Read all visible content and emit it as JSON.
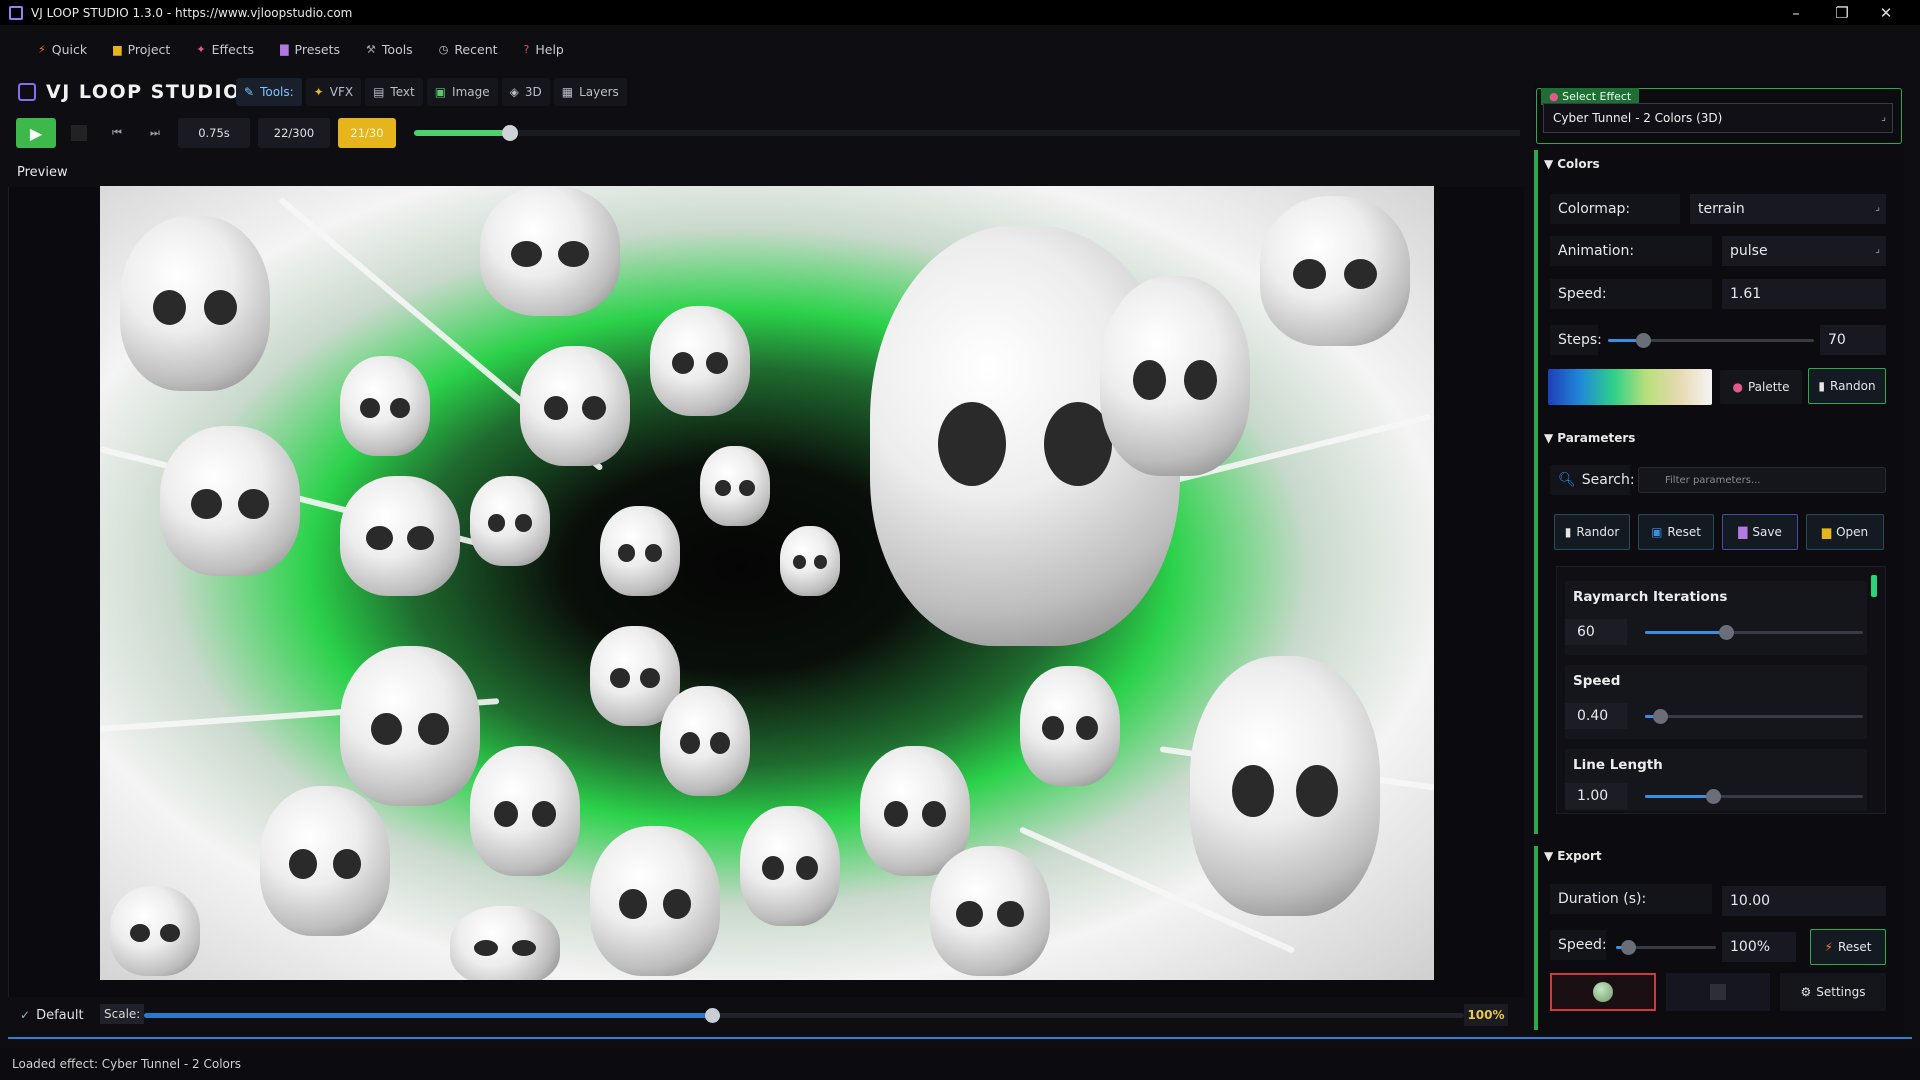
{
  "window": {
    "title": "VJ LOOP STUDIO 1.3.0 - https://www.vjloopstudio.com",
    "controls": [
      "–",
      "❐",
      "✕"
    ]
  },
  "menu": [
    {
      "icon": "⚡",
      "label": "Quick"
    },
    {
      "icon": "▆",
      "label": "Project"
    },
    {
      "icon": "✦",
      "label": "Effects"
    },
    {
      "icon": "▇",
      "label": "Presets"
    },
    {
      "icon": "⚒",
      "label": "Tools"
    },
    {
      "icon": "◷",
      "label": "Recent"
    },
    {
      "icon": "?",
      "label": "Help"
    }
  ],
  "brand": {
    "name": "VJ LOOP STUDIO"
  },
  "tabs": [
    {
      "icon": "✎",
      "label": "Tools:"
    },
    {
      "icon": "✦",
      "label": "VFX"
    },
    {
      "icon": "▤",
      "label": "Text"
    },
    {
      "icon": "▣",
      "label": "Image"
    },
    {
      "icon": "◈",
      "label": "3D"
    },
    {
      "icon": "▦",
      "label": "Layers"
    }
  ],
  "transport": {
    "time": "0.75s",
    "frame": "22/300",
    "fps": "21/30",
    "progress": 0.08
  },
  "preview": {
    "label": "Preview",
    "preset": "Default",
    "scale_label": "Scale:",
    "scale_value": "100%",
    "scale_fraction": 0.43
  },
  "status": {
    "text": "Loaded effect: Cyber Tunnel - 2 Colors"
  },
  "select_effect": {
    "label": "Select Effect",
    "value": "Cyber Tunnel - 2 Colors (3D)"
  },
  "colors": {
    "header": "Colors",
    "colormap_label": "Colormap:",
    "colormap_value": "terrain",
    "animation_label": "Animation:",
    "animation_value": "pulse",
    "speed_label": "Speed:",
    "speed_value": "1.61",
    "steps_label": "Steps:",
    "steps_value": "70",
    "steps_fraction": 0.17,
    "palette_button": "Palette",
    "random_button": "Randon"
  },
  "parameters": {
    "header": "Parameters",
    "search_label": "Search:",
    "search_placeholder": "Filter parameters...",
    "buttons": {
      "random": "Randor",
      "reset": "Reset",
      "save": "Save",
      "open": "Open"
    },
    "items": [
      {
        "name": "Raymarch Iterations",
        "value": "60",
        "fraction": 0.37
      },
      {
        "name": "Speed",
        "value": "0.40",
        "fraction": 0.07
      },
      {
        "name": "Line Length",
        "value": "1.00",
        "fraction": 0.31
      }
    ]
  },
  "export": {
    "header": "Export",
    "duration_label": "Duration (s):",
    "duration_value": "10.00",
    "speed_label": "Speed:",
    "speed_value": "100%",
    "speed_fraction": 0.12,
    "reset_button": "Reset",
    "settings_button": "Settings"
  },
  "colors_accent": {
    "green": "#2ea84a",
    "play": "#3db84a",
    "fps": "#e6b51e",
    "record": "#d03a3a",
    "scale": "#2a78c8"
  }
}
